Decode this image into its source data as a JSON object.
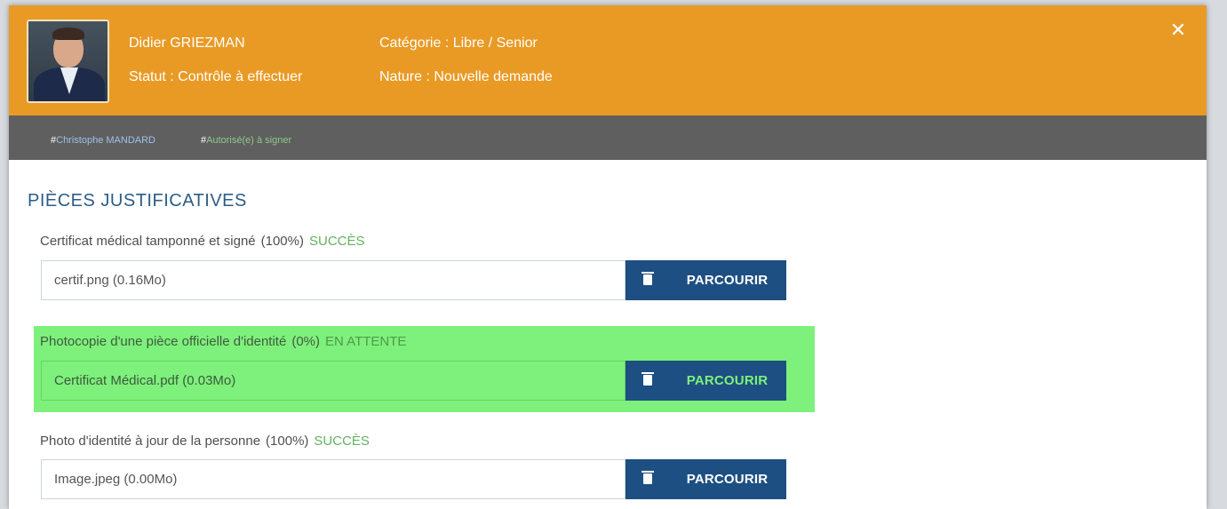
{
  "header": {
    "name": "Didier GRIEZMAN",
    "statut": "Statut : Contrôle à effectuer",
    "categorie": "Catégorie : Libre / Senior",
    "nature": "Nature : Nouvelle demande",
    "close_icon": "✕"
  },
  "tags": [
    {
      "hash": "#",
      "label": "Christophe MANDARD"
    },
    {
      "hash": "#",
      "label": "Autorisé(e) à signer"
    }
  ],
  "section": {
    "title": "PIÈCES JUSTIFICATIVES"
  },
  "documents": [
    {
      "label": "Certificat médical tamponné et signé",
      "percent": "(100%)",
      "status": "SUCCÈS",
      "file": "certif.png  (0.16Mo)",
      "browse_label": "PARCOURIR"
    },
    {
      "label": "Photocopie d'une pièce officielle d'identité",
      "percent": "(0%)",
      "status": "EN ATTENTE",
      "file": "Certificat Médical.pdf  (0.03Mo)",
      "browse_label": "PARCOURIR"
    },
    {
      "label": "Photo d'identité à jour de la personne",
      "percent": "(100%)",
      "status": "SUCCÈS",
      "file": "Image.jpeg  (0.00Mo)",
      "browse_label": "PARCOURIR"
    }
  ],
  "colors": {
    "header_bg": "#e99a25",
    "tagbar_bg": "#5f5f5f",
    "primary_button": "#1d4f82",
    "success": "#63b160",
    "highlight": "#7ef07c",
    "section_title": "#2c5d88"
  },
  "icons": {
    "avatar": "profile-photo",
    "trash": "trash-icon",
    "close": "close-icon"
  }
}
